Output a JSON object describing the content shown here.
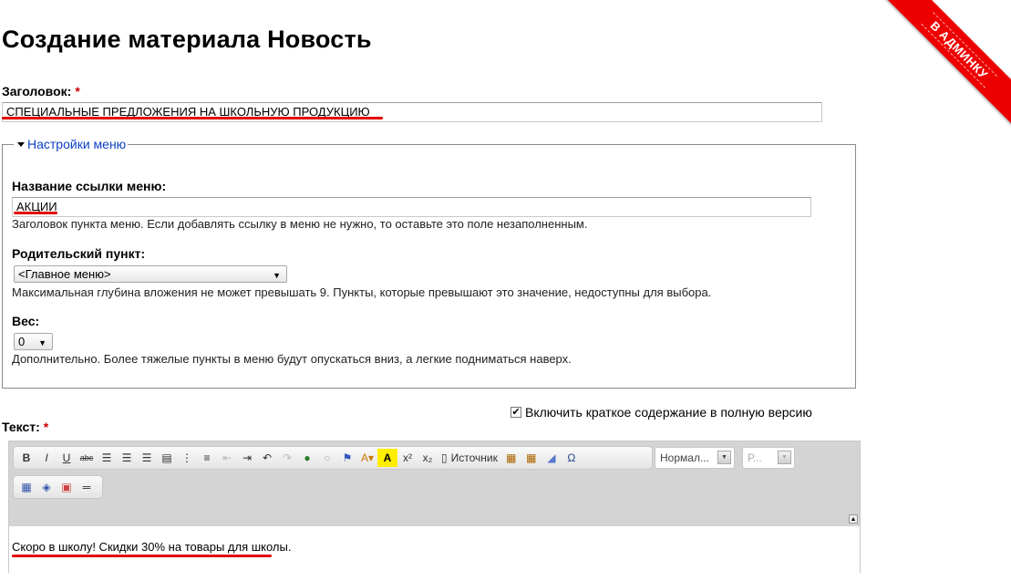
{
  "page": {
    "title": "Создание материала Новость"
  },
  "corner_link": {
    "label": "В АДМИНКУ",
    "color": "#ee0000"
  },
  "title_field": {
    "label": "Заголовок:",
    "required_mark": "*",
    "value": "СПЕЦИАЛЬНЫЕ ПРЕДЛОЖЕНИЯ НА ШКОЛЬНУЮ ПРОДУКЦИЮ"
  },
  "menu_settings": {
    "legend": "Настройки меню",
    "link_title": {
      "label": "Название ссылки меню:",
      "value": "АКЦИИ",
      "description": "Заголовок пункта меню. Если добавлять ссылку в меню не нужно, то оставьте это поле незаполненным."
    },
    "parent": {
      "label": "Родительский пункт:",
      "selected": "<Главное меню>",
      "description": "Максимальная глубина вложения не может превышать 9. Пункты, которые превышают это значение, недоступны для выбора."
    },
    "weight": {
      "label": "Вес:",
      "selected": "0",
      "description": "Дополнительно. Более тяжелые пункты в меню будут опускаться вниз, а легкие подниматься наверх."
    }
  },
  "summary_checkbox": {
    "label": "Включить краткое содержание в полную версию",
    "checked": true,
    "mark": "✔"
  },
  "body_field": {
    "label": "Текст:",
    "required_mark": "*",
    "toolbar": {
      "bold": "B",
      "italic": "I",
      "underline": "U",
      "strike": "abc",
      "source": "Источник",
      "superscript": "x²",
      "subscript": "x₂",
      "format_combo": "Нормал...",
      "font_combo": "Р..."
    },
    "content": "Скоро в школу! Скидки 30% на товары для школы."
  },
  "accent_colors": {
    "highlight_underline": "#e00000",
    "link": "#0b3fc4"
  }
}
